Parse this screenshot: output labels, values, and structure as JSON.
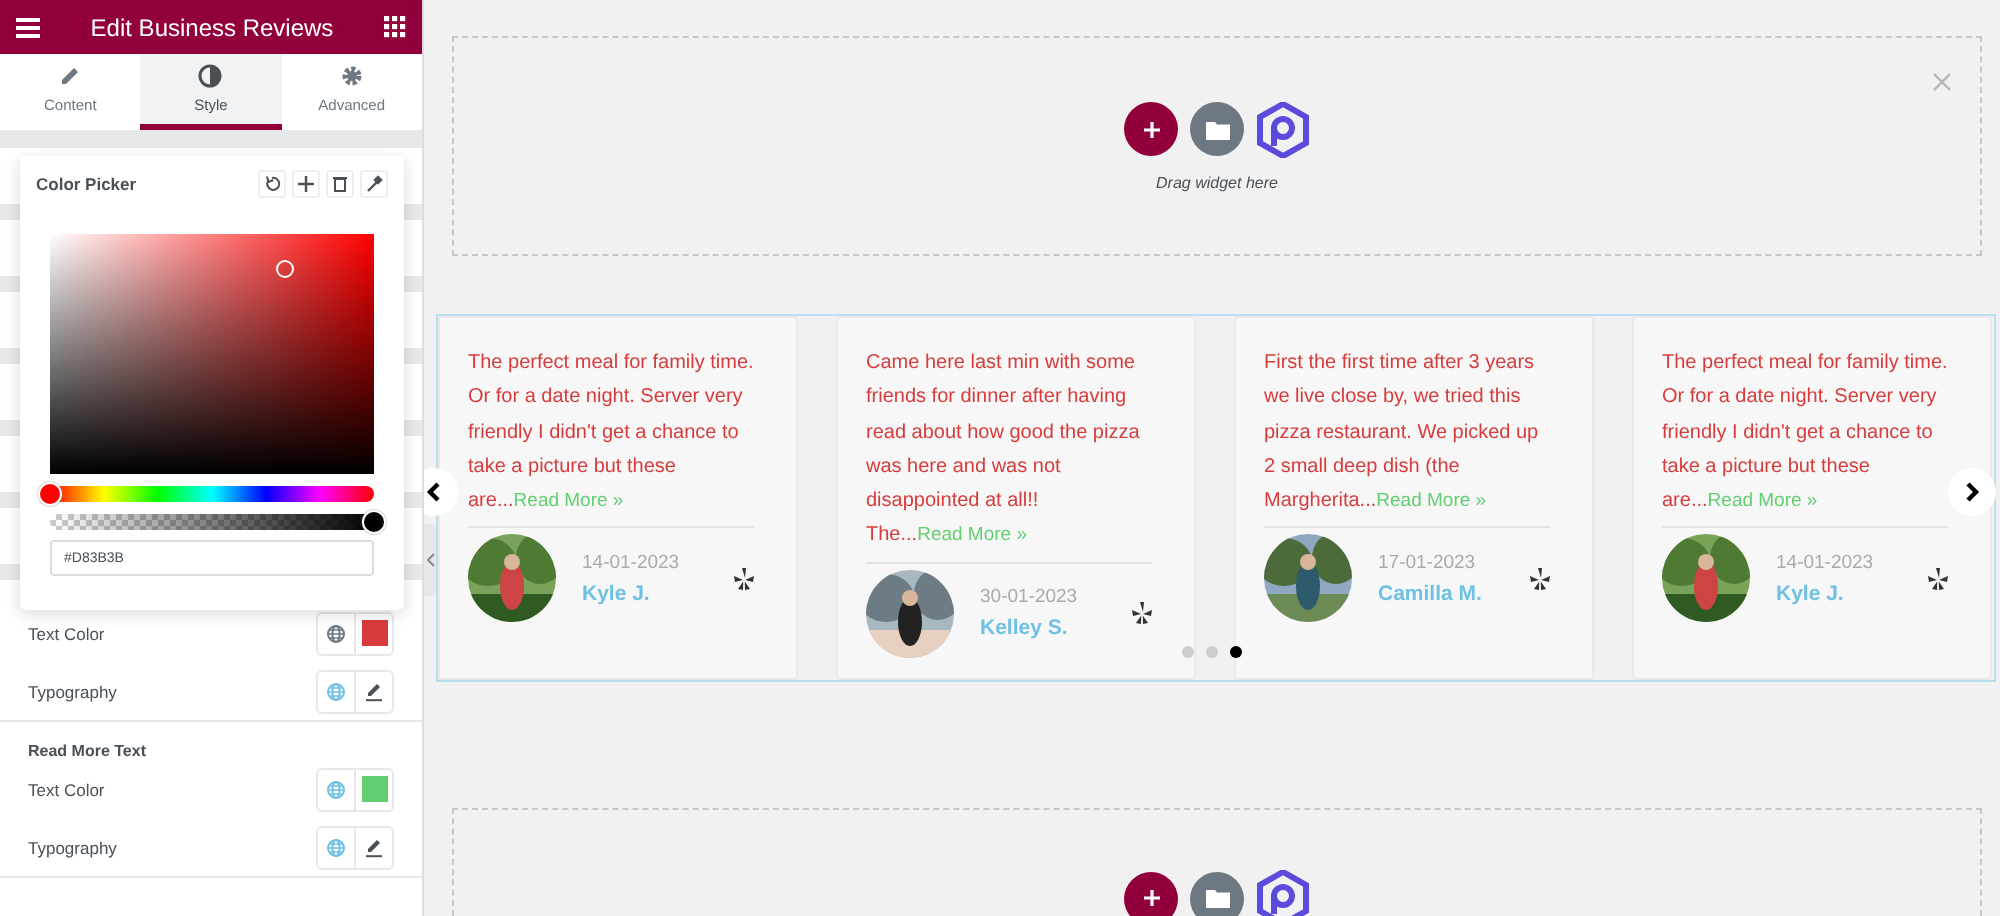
{
  "editor": {
    "title": "Edit Business Reviews",
    "tabs": [
      {
        "label": "Content",
        "selected": false
      },
      {
        "label": "Style",
        "selected": true
      },
      {
        "label": "Advanced",
        "selected": false
      }
    ]
  },
  "color_picker": {
    "title": "Color Picker",
    "value": "#D83B3B",
    "hue_slider": {
      "level": 0
    },
    "alpha_slider": {
      "level": 1
    }
  },
  "style_sections": [
    {
      "rows": [
        {
          "kind": "color",
          "label": "Text Color",
          "global": false,
          "color": "#d83b3b"
        },
        {
          "kind": "typography",
          "label": "Typography",
          "global": true
        }
      ]
    },
    {
      "title": "Read More Text",
      "rows": [
        {
          "kind": "color",
          "label": "Text Color",
          "global": true,
          "color": "#61ce70"
        },
        {
          "kind": "typography",
          "label": "Typography",
          "global": true
        }
      ]
    }
  ],
  "drop_zones": [
    {
      "hint": "Drag widget here",
      "closable": true
    },
    {
      "closable": false
    }
  ],
  "reviews": [
    {
      "text": "The perfect meal for family time. Or for a date night. Server very friendly I didn't get a chance to take a picture but these are...",
      "read_more": "Read More »",
      "date": "14-01-2023",
      "name": "Kyle J."
    },
    {
      "text": "Came here last min with some friends for dinner after having read about how good the pizza was here and was not disappointed at all!! The...",
      "read_more": "Read More »",
      "date": "30-01-2023",
      "name": "Kelley S."
    },
    {
      "text": "First the first time after 3 years we live close by, we tried this pizza restaurant. We picked up 2 small deep dish (the Margherita...",
      "read_more": "Read More »",
      "date": "17-01-2023",
      "name": "Camilla M."
    },
    {
      "text": "The perfect meal for family time. Or for a date night. Server very friendly I didn't get a chance to take a picture but these are...",
      "read_more": "Read More »",
      "date": "14-01-2023",
      "name": "Kyle J."
    }
  ],
  "pagination": [
    {
      "selected": false
    },
    {
      "selected": false
    },
    {
      "selected": true
    }
  ]
}
